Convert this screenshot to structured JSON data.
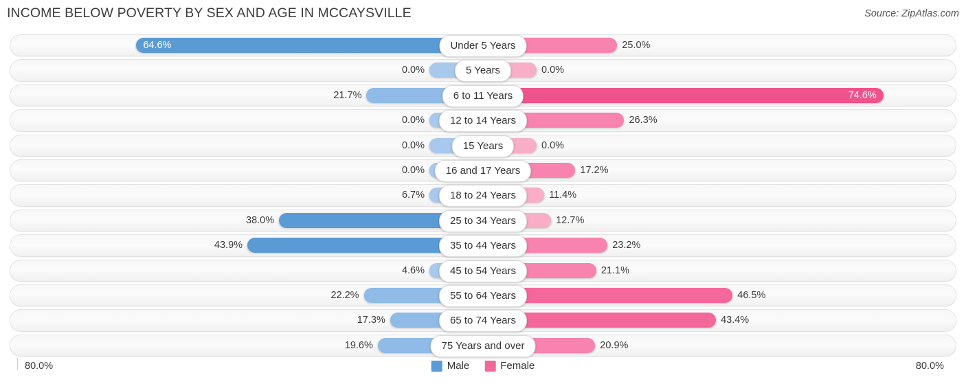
{
  "header": {
    "title": "INCOME BELOW POVERTY BY SEX AND AGE IN MCCAYSVILLE",
    "source": "Source: ZipAtlas.com"
  },
  "legend": {
    "male_label": "Male",
    "female_label": "Female",
    "male_color": "#5b9bd5",
    "female_color": "#f4679b"
  },
  "axis": {
    "left_label": "80.0%",
    "right_label": "80.0%",
    "max": 80.0
  },
  "chart_data": {
    "type": "bar",
    "orientation": "horizontal-diverging",
    "title": "INCOME BELOW POVERTY BY SEX AND AGE IN MCCAYSVILLE",
    "xlabel": "",
    "ylabel": "",
    "xlim": [
      0,
      80
    ],
    "grid": false,
    "legend_position": "bottom-center",
    "categories": [
      "Under 5 Years",
      "5 Years",
      "6 to 11 Years",
      "12 to 14 Years",
      "15 Years",
      "16 and 17 Years",
      "18 to 24 Years",
      "25 to 34 Years",
      "35 to 44 Years",
      "45 to 54 Years",
      "55 to 64 Years",
      "65 to 74 Years",
      "75 Years and over"
    ],
    "series": [
      {
        "name": "Male",
        "values": [
          64.6,
          0.0,
          21.7,
          0.0,
          0.0,
          0.0,
          6.7,
          38.0,
          43.9,
          4.6,
          22.2,
          17.3,
          19.6
        ],
        "labels": [
          "64.6%",
          "0.0%",
          "21.7%",
          "0.0%",
          "0.0%",
          "0.0%",
          "6.7%",
          "38.0%",
          "43.9%",
          "4.6%",
          "22.2%",
          "17.3%",
          "19.6%"
        ]
      },
      {
        "name": "Female",
        "values": [
          25.0,
          0.0,
          74.6,
          26.3,
          0.0,
          17.2,
          11.4,
          12.7,
          23.2,
          21.1,
          46.5,
          43.4,
          20.9
        ],
        "labels": [
          "25.0%",
          "0.0%",
          "74.6%",
          "26.3%",
          "0.0%",
          "17.2%",
          "11.4%",
          "12.7%",
          "23.2%",
          "21.1%",
          "46.5%",
          "43.4%",
          "20.9%"
        ]
      }
    ]
  },
  "rows": [
    {
      "label": "Under 5 Years",
      "male": 64.6,
      "male_label": "64.6%",
      "female": 25.0,
      "female_label": "25.0%"
    },
    {
      "label": "5 Years",
      "male": 0.0,
      "male_label": "0.0%",
      "female": 0.0,
      "female_label": "0.0%"
    },
    {
      "label": "6 to 11 Years",
      "male": 21.7,
      "male_label": "21.7%",
      "female": 74.6,
      "female_label": "74.6%"
    },
    {
      "label": "12 to 14 Years",
      "male": 0.0,
      "male_label": "0.0%",
      "female": 26.3,
      "female_label": "26.3%"
    },
    {
      "label": "15 Years",
      "male": 0.0,
      "male_label": "0.0%",
      "female": 0.0,
      "female_label": "0.0%"
    },
    {
      "label": "16 and 17 Years",
      "male": 0.0,
      "male_label": "0.0%",
      "female": 17.2,
      "female_label": "17.2%"
    },
    {
      "label": "18 to 24 Years",
      "male": 6.7,
      "male_label": "6.7%",
      "female": 11.4,
      "female_label": "11.4%"
    },
    {
      "label": "25 to 34 Years",
      "male": 38.0,
      "male_label": "38.0%",
      "female": 12.7,
      "female_label": "12.7%"
    },
    {
      "label": "35 to 44 Years",
      "male": 43.9,
      "male_label": "43.9%",
      "female": 23.2,
      "female_label": "23.2%"
    },
    {
      "label": "45 to 54 Years",
      "male": 4.6,
      "male_label": "4.6%",
      "female": 21.1,
      "female_label": "21.1%"
    },
    {
      "label": "55 to 64 Years",
      "male": 22.2,
      "male_label": "22.2%",
      "female": 46.5,
      "female_label": "46.5%"
    },
    {
      "label": "65 to 74 Years",
      "male": 17.3,
      "male_label": "17.3%",
      "female": 43.4,
      "female_label": "43.4%"
    },
    {
      "label": "75 Years and over",
      "male": 19.6,
      "male_label": "19.6%",
      "female": 20.9,
      "female_label": "20.9%"
    }
  ]
}
